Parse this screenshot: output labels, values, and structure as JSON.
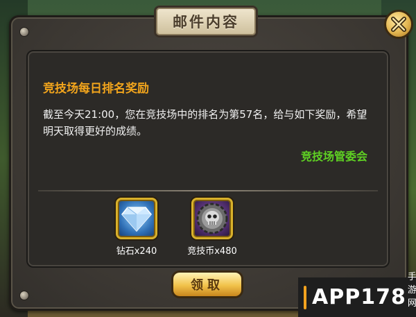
{
  "window": {
    "title": "邮件内容"
  },
  "mail": {
    "subject": "竞技场每日排名奖励",
    "body": "截至今天21:00，您在竞技场中的排名为第57名，给与如下奖励，希望明天取得更好的成绩。",
    "sender": "竞技场管委会"
  },
  "rewards": [
    {
      "name": "钻石x240",
      "icon": "diamond-icon"
    },
    {
      "name": "竞技币x480",
      "icon": "skull-coin-icon"
    }
  ],
  "buttons": {
    "claim": "领取",
    "close_icon": "close-icon"
  },
  "watermark": {
    "brand": "APP178",
    "sub": "手游网"
  },
  "colors": {
    "title": "#f3a51c",
    "sender": "#5fd123",
    "gold": "#d9b12a"
  }
}
